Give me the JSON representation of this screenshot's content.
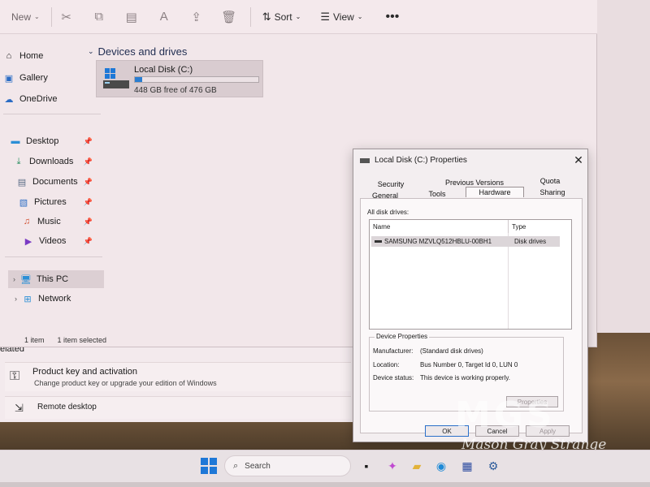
{
  "toolbar": {
    "new_label": "New",
    "sort_label": "Sort",
    "view_label": "View"
  },
  "nav": {
    "items": [
      {
        "label": "Home",
        "icon": "home-icon"
      },
      {
        "label": "Gallery",
        "icon": "gallery-icon"
      },
      {
        "label": "OneDrive",
        "icon": "cloud-icon"
      },
      {
        "label": "Desktop",
        "icon": "desktop-icon"
      },
      {
        "label": "Downloads",
        "icon": "download-icon"
      },
      {
        "label": "Documents",
        "icon": "document-icon"
      },
      {
        "label": "Pictures",
        "icon": "picture-icon"
      },
      {
        "label": "Music",
        "icon": "music-icon"
      },
      {
        "label": "Videos",
        "icon": "video-icon"
      },
      {
        "label": "This PC",
        "icon": "computer-icon"
      },
      {
        "label": "Network",
        "icon": "network-icon"
      }
    ]
  },
  "status": {
    "count": "1 item",
    "selected": "1 item selected"
  },
  "content": {
    "section_title": "Devices and drives",
    "drive": {
      "name": "Local Disk (C:)",
      "free_text": "448 GB free of 476 GB",
      "used_fraction": 0.059
    }
  },
  "settings": {
    "related": "elated",
    "product_key_title": "Product key and activation",
    "product_key_desc": "Change product key or upgrade your edition of Windows",
    "remote_desktop": "Remote desktop"
  },
  "dialog": {
    "title": "Local Disk (C:) Properties",
    "tabs_top": [
      "Security",
      "Previous Versions",
      "Quota"
    ],
    "tabs_bottom": [
      "General",
      "Tools",
      "Hardware",
      "Sharing"
    ],
    "active_tab": "Hardware",
    "list_label": "All disk drives:",
    "columns": [
      "Name",
      "Type"
    ],
    "rows": [
      {
        "name": "SAMSUNG MZVLQ512HBLU-00BH1",
        "type": "Disk drives"
      }
    ],
    "device_properties": {
      "title": "Device Properties",
      "manufacturer_label": "Manufacturer:",
      "manufacturer_value": "(Standard disk drives)",
      "location_label": "Location:",
      "location_value": "Bus Number 0, Target Id 0, LUN 0",
      "status_label": "Device status:",
      "status_value": "This device is working properly."
    },
    "properties_button": "Properties",
    "ok_button": "OK",
    "cancel_button": "Cancel",
    "apply_button": "Apply"
  },
  "taskbar": {
    "search_placeholder": "Search"
  },
  "watermark": {
    "letters": "MGS",
    "name": "Mason Gray Strange"
  }
}
